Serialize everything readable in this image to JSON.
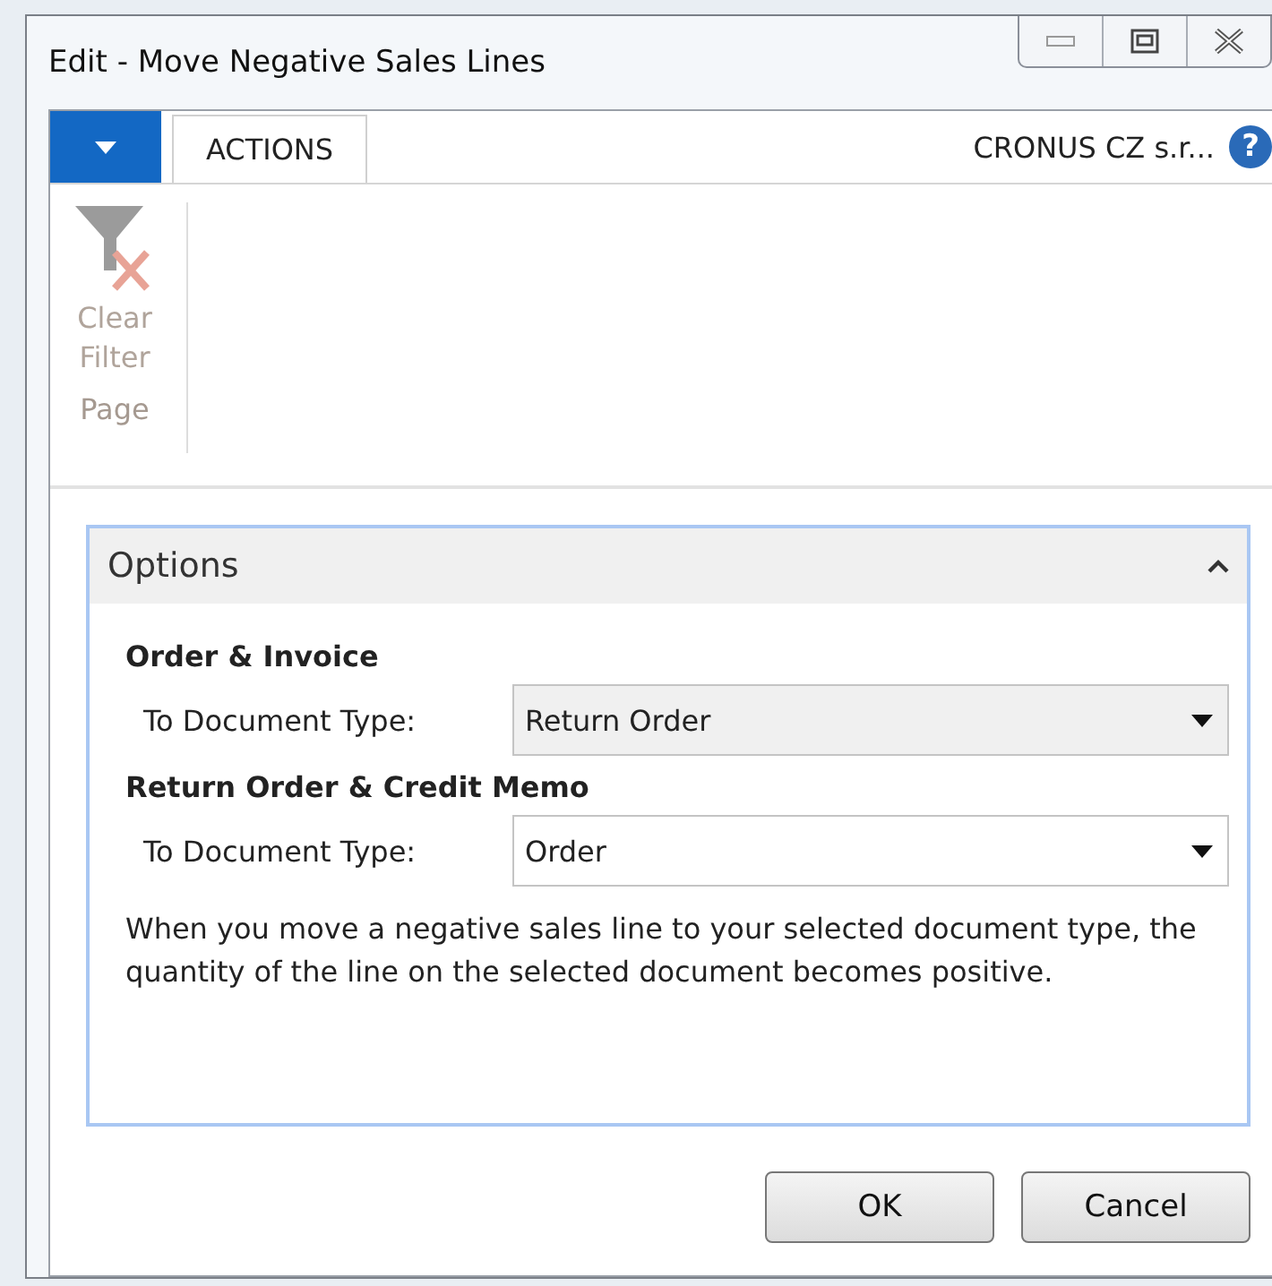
{
  "window": {
    "title": "Edit - Move Negative Sales Lines"
  },
  "ribbon": {
    "tabs": [
      {
        "label": "ACTIONS",
        "selected": true
      }
    ],
    "company": "CRONUS CZ s.r...",
    "help": "?",
    "groups": [
      {
        "label": "Page",
        "actions": [
          {
            "label": "Clear Filter",
            "disabled": true
          }
        ]
      }
    ]
  },
  "options": {
    "title": "Options",
    "expanded": true,
    "sections": [
      {
        "heading": "Order & Invoice",
        "fields": [
          {
            "label": "To Document Type:",
            "value": "Return Order"
          }
        ]
      },
      {
        "heading": "Return Order & Credit Memo",
        "fields": [
          {
            "label": "To Document Type:",
            "value": "Order"
          }
        ]
      }
    ],
    "note": "When you move a negative sales line to your selected document type, the quantity of the line on the selected document becomes positive."
  },
  "buttons": [
    "OK",
    "Cancel"
  ]
}
